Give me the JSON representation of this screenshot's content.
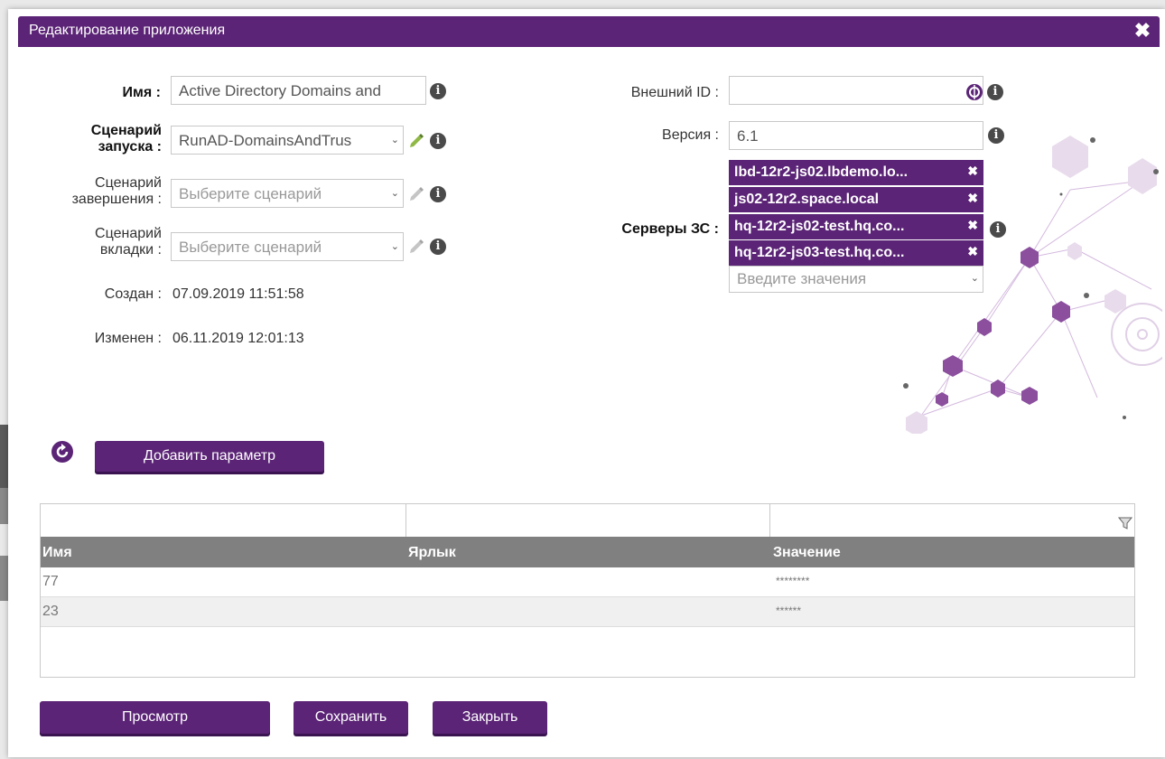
{
  "dialog": {
    "title": "Редактирование приложения"
  },
  "form_left": {
    "name_label": "Имя :",
    "name_value": "Active Directory Domains and",
    "launch_label_1": "Сценарий",
    "launch_label_2": "запуска :",
    "launch_value": "RunAD-DomainsAndTrus",
    "finish_label_1": "Сценарий",
    "finish_label_2": "завершения :",
    "finish_placeholder": "Выберите сценарий",
    "tab_label_1": "Сценарий",
    "tab_label_2": "вкладки :",
    "tab_placeholder": "Выберите сценарий",
    "created_label": "Создан :",
    "created_value": "07.09.2019 11:51:58",
    "modified_label": "Изменен :",
    "modified_value": "06.11.2019 12:01:13"
  },
  "form_right": {
    "external_id_label": "Внешний ID :",
    "external_id_value": "",
    "version_label": "Версия :",
    "version_value": "6.1",
    "servers_label": "Серверы ЗС :",
    "servers": [
      "lbd-12r2-js02.lbdemo.lo...",
      "js02-12r2.space.local",
      "hq-12r2-js02-test.hq.co...",
      "hq-12r2-js03-test.hq.co..."
    ],
    "servers_placeholder": "Введите значения"
  },
  "params": {
    "add_button": "Добавить параметр",
    "columns": [
      "Имя",
      "Ярлык",
      "Значение"
    ],
    "rows": [
      {
        "name": "77",
        "label": "",
        "value": "********"
      },
      {
        "name": "23",
        "label": "",
        "value": "******"
      }
    ]
  },
  "footer": {
    "preview": "Просмотр",
    "save": "Сохранить",
    "close": "Закрыть"
  },
  "icons": {
    "close": "close-icon",
    "info": "info-icon",
    "edit": "pencil-icon",
    "globe": "globe-icon",
    "refresh": "refresh-icon",
    "filter": "filter-icon"
  },
  "colors": {
    "accent": "#5b2476",
    "header_gray": "#808080"
  }
}
